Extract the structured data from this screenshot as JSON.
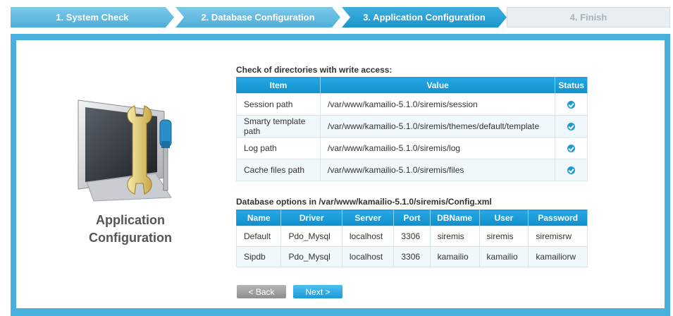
{
  "steps": [
    {
      "label": "1. System Check",
      "state": "done"
    },
    {
      "label": "2. Database Configuration",
      "state": "done"
    },
    {
      "label": "3. Application Configuration",
      "state": "active"
    },
    {
      "label": "4. Finish",
      "state": "todo"
    }
  ],
  "sidebar": {
    "title_line1": "Application",
    "title_line2": "Configuration"
  },
  "dirs": {
    "title": "Check of directories with write access:",
    "headers": [
      "Item",
      "Value",
      "Status"
    ],
    "rows": [
      {
        "item": "Session path",
        "value": "/var/www/kamailio-5.1.0/siremis/session",
        "status": "ok"
      },
      {
        "item": "Smarty template path",
        "value": "/var/www/kamailio-5.1.0/siremis/themes/default/template",
        "status": "ok"
      },
      {
        "item": "Log path",
        "value": "/var/www/kamailio-5.1.0/siremis/log",
        "status": "ok"
      },
      {
        "item": "Cache files path",
        "value": "/var/www/kamailio-5.1.0/siremis/files",
        "status": "ok"
      }
    ]
  },
  "db": {
    "title": "Database options in /var/www/kamailio-5.1.0/siremis/Config.xml",
    "headers": [
      "Name",
      "Driver",
      "Server",
      "Port",
      "DBName",
      "User",
      "Password"
    ],
    "rows": [
      [
        "Default",
        "Pdo_Mysql",
        "localhost",
        "3306",
        "siremis",
        "siremis",
        "siremisrw"
      ],
      [
        "Sipdb",
        "Pdo_Mysql",
        "localhost",
        "3306",
        "kamailio",
        "kamailio",
        "kamailiorw"
      ]
    ]
  },
  "buttons": {
    "back": "< Back",
    "next": "Next >"
  },
  "icons": {
    "status_ok": "check-circle-icon",
    "illustration": "monitor-wrench-screwdriver-icon"
  },
  "colors": {
    "accent": "#1e9ad6",
    "frame": "#48b0dc",
    "header": "#0f8fcc"
  }
}
